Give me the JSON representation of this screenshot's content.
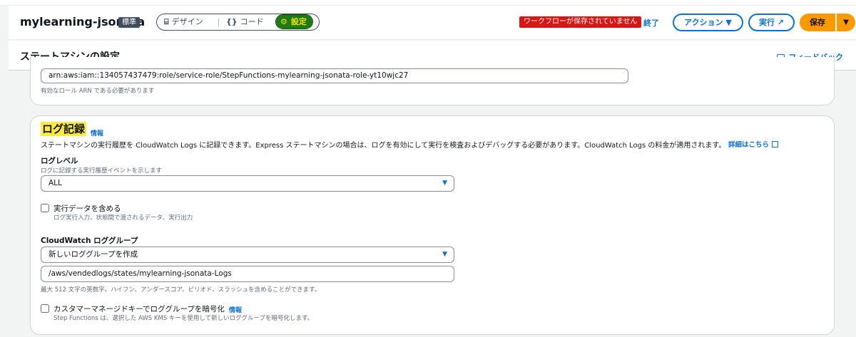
{
  "app": {
    "title": "mylearning-jsonata",
    "badge": "標準"
  },
  "mode_segment": {
    "design": {
      "icon": "diagram-icon",
      "glyph": "⌸",
      "label": "デザイン"
    },
    "code": {
      "icon": "code-icon",
      "glyph": "{}",
      "label": "コード"
    },
    "settings": {
      "icon": "gear-icon",
      "glyph": "⚙",
      "label": "設定"
    }
  },
  "header_actions": {
    "unsaved_badge": "ワークフローが保存されていません",
    "exit_label": "終了",
    "action_label": "アクション ▼",
    "run_label": "実行 ↗",
    "save_label": "保存",
    "save_caret": "▼"
  },
  "page": {
    "title": "ステートマシンの設定",
    "feedback": "フィードバック"
  },
  "role_section": {
    "arn_value": "arn:aws:iam::134057437479:role/service-role/StepFunctions-mylearning-jsonata-role-yt10wjc27",
    "arn_hint": "有効なロール ARN である必要があります"
  },
  "logging": {
    "title": "ログ記録",
    "info": "情報",
    "description": "ステートマシンの実行履歴を CloudWatch Logs に記録できます。Express ステートマシンの場合は、ログを有効にして実行を検査およびデバッグする必要があります。CloudWatch Logs の料金が適用されます。",
    "learn_more": "詳細はこちら",
    "log_level": {
      "label": "ログレベル",
      "hint": "ログに記録する実行履歴イベントを示します",
      "value": "ALL"
    },
    "include_data": {
      "checked": false,
      "label": "実行データを含める",
      "hint": "ログ実行入力、状態間で渡されるデータ、実行出力"
    },
    "log_group": {
      "label": "CloudWatch ロググループ",
      "select_value": "新しいロググループを作成",
      "name_value": "/aws/vendedlogs/states/mylearning-jsonata-Logs",
      "name_hint": "最大 512 文字の英数字。ハイフン、アンダースコア、ピリオド、スラッシュを含めることができます。"
    },
    "encrypt": {
      "checked": false,
      "label": "カスタマーマネージドキーでロググループを暗号化",
      "info": "情報",
      "hint": "Step Functions は、選択した AWS KMS キーを使用して新しいロググループを暗号化します。"
    }
  }
}
